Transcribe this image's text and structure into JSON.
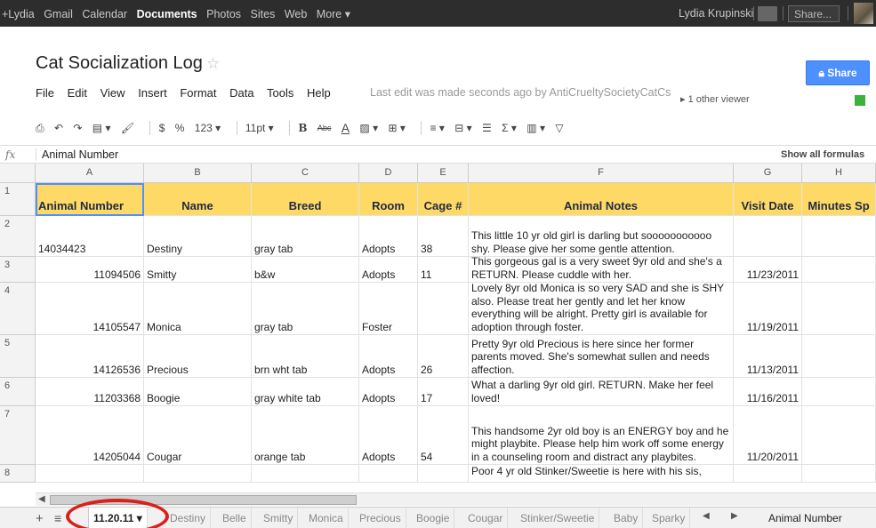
{
  "gbar": {
    "links": [
      "+Lydia",
      "Gmail",
      "Calendar",
      "Documents",
      "Photos",
      "Sites",
      "Web",
      "More ▾"
    ],
    "active_link": "Documents",
    "user_name": "Lydia Krupinski",
    "share_label": "Share..."
  },
  "doc": {
    "title": "Cat Socialization Log",
    "menu": [
      "File",
      "Edit",
      "View",
      "Insert",
      "Format",
      "Data",
      "Tools",
      "Help"
    ],
    "last_edit": "Last edit was made seconds ago by AntiCrueltySocietyCatCs",
    "viewers": "▸ 1 other viewer",
    "share_button": "Share"
  },
  "toolbar": {
    "currency": "$",
    "percent": "%",
    "number_format": "123 ▾",
    "font_size": "11pt ▾",
    "bold": "B",
    "strike": "Abc",
    "text_color": "A",
    "sum": "Σ ▾"
  },
  "formula_bar": {
    "fx": "fx",
    "value": "Animal Number",
    "show_all": "Show all formulas"
  },
  "grid": {
    "columns": [
      "A",
      "B",
      "C",
      "D",
      "E",
      "F",
      "G",
      "H"
    ],
    "header_row": [
      "Animal Number",
      "Name",
      "Breed",
      "Room",
      "Cage #",
      "Animal Notes",
      "Visit Date",
      "Minutes Sp"
    ],
    "row_numbers": [
      "1",
      "2",
      "3",
      "4",
      "5",
      "6",
      "7",
      "8"
    ],
    "rows": [
      {
        "number": "14034423",
        "name": "Destiny",
        "breed": "gray tab",
        "room": "Adopts",
        "cage": "38",
        "notes": "This little 10 yr old girl is darling but sooooooooooo shy. Please give her some gentle attention.",
        "date": ""
      },
      {
        "number": "11094506",
        "name": "Smitty",
        "breed": "b&w",
        "room": "Adopts",
        "cage": "11",
        "notes": "This gorgeous gal is a very sweet 9yr old and she's a RETURN. Please cuddle with her.",
        "date": "11/23/2011"
      },
      {
        "number": "14105547",
        "name": "Monica",
        "breed": "gray tab",
        "room": "Foster",
        "cage": "",
        "notes": "Lovely 8yr old Monica is so very SAD and she is SHY also. Please treat her gently and let her know everything will be alright. Pretty girl is available for adoption through foster.",
        "date": "11/19/2011"
      },
      {
        "number": "14126536",
        "name": "Precious",
        "breed": "brn wht tab",
        "room": "Adopts",
        "cage": "26",
        "notes": "Pretty 9yr old Precious is here since her former parents moved. She's somewhat sullen and needs affection.",
        "date": "11/13/2011"
      },
      {
        "number": "11203368",
        "name": "Boogie",
        "breed": "gray white tab",
        "room": "Adopts",
        "cage": "17",
        "notes": "What a darling 9yr old girl. RETURN. Make her feel loved!",
        "date": "11/16/2011"
      },
      {
        "number": "14205044",
        "name": "Cougar",
        "breed": "orange tab",
        "room": "Adopts",
        "cage": "54",
        "notes": "This handsome 2yr old boy is an ENERGY boy and he might playbite. Please help him work off some energy in a counseling room and distract any playbites.",
        "date": "11/20/2011"
      },
      {
        "number": "",
        "name": "",
        "breed": "",
        "room": "",
        "cage": "",
        "notes": "Poor 4 yr old Stinker/Sweetie is here with his sis,",
        "date": ""
      }
    ]
  },
  "tabs": {
    "active": "11.20.11 ▾",
    "others": [
      "Destiny",
      "Belle",
      "Smitty",
      "Monica",
      "Precious",
      "Boogie",
      "Cougar",
      "Stinker/Sweetie",
      "Baby",
      "Sparky"
    ],
    "cell_ref": "Animal Number"
  },
  "colors": {
    "header_fill": "#ffd966",
    "share_blue": "#4d90fe",
    "annotation_circle": "#d9201a"
  }
}
